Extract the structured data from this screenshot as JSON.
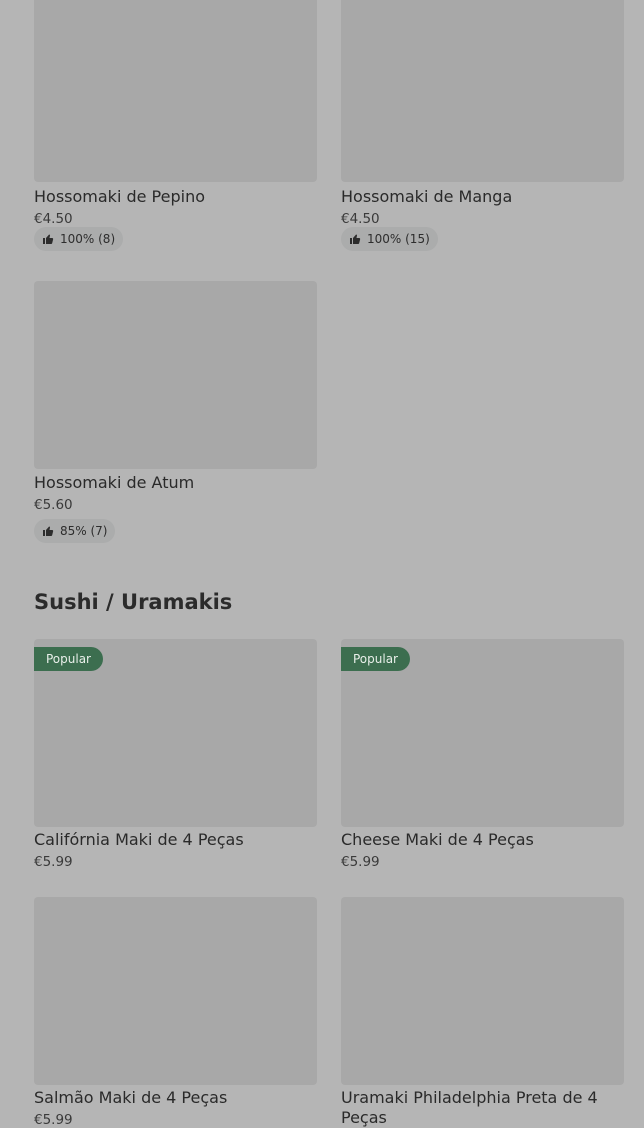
{
  "sections": [
    {
      "title": "",
      "items": [
        {
          "name": "Hossomaki de Pepino",
          "price": "€4.50",
          "rating": "100% (8)",
          "badge": ""
        },
        {
          "name": "Hossomaki de Manga",
          "price": "€4.50",
          "rating": "100% (15)",
          "badge": ""
        },
        {
          "name": "Hossomaki de Atum",
          "price": "€5.60",
          "rating": "85% (7)",
          "badge": ""
        }
      ]
    },
    {
      "title": "Sushi / Uramakis",
      "items": [
        {
          "name": "Califórnia Maki de 4 Peças",
          "price": "€5.99",
          "badge": "Popular"
        },
        {
          "name": "Cheese Maki de 4 Peças",
          "price": "€5.99",
          "badge": "Popular"
        },
        {
          "name": "Salmão Maki de 4 Peças",
          "price": "€5.99",
          "badge": ""
        },
        {
          "name": "Uramaki Philadelphia Preta de 4 Peças",
          "price": "",
          "badge": ""
        }
      ]
    }
  ],
  "icons": {
    "rating": "thumbs-up-icon"
  }
}
